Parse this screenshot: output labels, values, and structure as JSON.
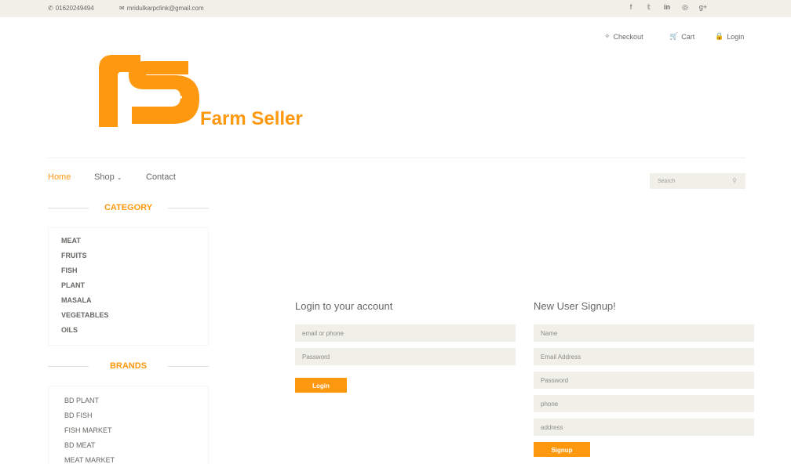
{
  "topbar": {
    "phone": "01620249494",
    "email": "mridulkarpclink@gmail.com",
    "social": [
      "f",
      "t",
      "in",
      "dr",
      "g+"
    ]
  },
  "header": {
    "checkout": "Checkout",
    "cart": "Cart",
    "login": "Login"
  },
  "logo": {
    "text": "Farm Seller",
    "color": "#fe980f"
  },
  "nav": {
    "items": [
      {
        "label": "Home",
        "active": true
      },
      {
        "label": "Shop"
      },
      {
        "label": "Contact"
      }
    ],
    "search_placeholder": "Search"
  },
  "sidebar": {
    "category_title": "CATEGORY",
    "categories": [
      "MEAT",
      "FRUITS",
      "FISH",
      "PLANT",
      "MASALA",
      "VEGETABLES",
      "OILS"
    ],
    "brands_title": "BRANDS",
    "brands": [
      "BD PLANT",
      "BD FISH",
      "FISH MARKET",
      "BD MEAT",
      "MEAT MARKET"
    ]
  },
  "login": {
    "title": "Login to your account",
    "email_placeholder": "email or phone",
    "password_placeholder": "Password",
    "button": "Login"
  },
  "signup": {
    "title": "New User Signup!",
    "name_placeholder": "Name",
    "email_placeholder": "Email Address",
    "password_placeholder": "Password",
    "phone_placeholder": "phone",
    "address_placeholder": "address",
    "button": "Signup"
  },
  "colors": {
    "accent": "#fe980f",
    "bar": "#f0f0e9",
    "text": "#696763"
  }
}
